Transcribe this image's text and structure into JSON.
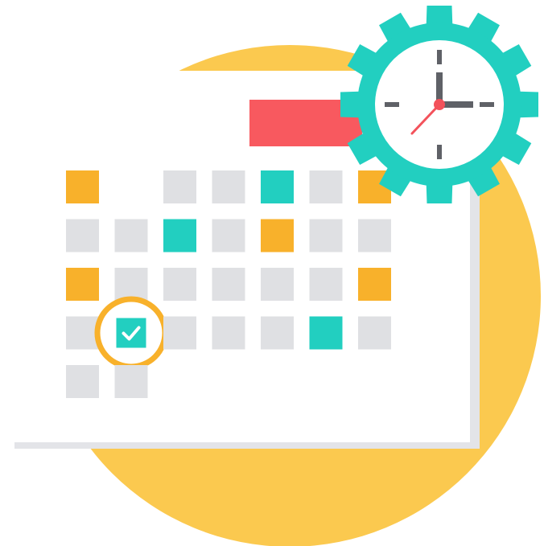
{
  "illustration": {
    "subject": "calendar-with-clock-gear",
    "colors": {
      "background": "#ffffff",
      "circle": "#fbc94f",
      "calendar_page": "#ffffff",
      "calendar_shadow": "#e3e4e8",
      "header_bar": "#f8595f",
      "cell_gray": "#dfe0e3",
      "cell_orange": "#f8b12b",
      "cell_teal": "#22cfc0",
      "ring": "#f8b12b",
      "gear": "#22cfc0",
      "clock_face": "#ffffff",
      "clock_hands": "#5f6167",
      "second_hand": "#f3525b"
    },
    "calendar_grid": {
      "rows": [
        [
          "orange",
          "empty",
          "gray",
          "gray",
          "teal",
          "gray",
          "orange"
        ],
        [
          "gray",
          "gray",
          "teal",
          "gray",
          "orange",
          "gray",
          "gray"
        ],
        [
          "orange",
          "gray",
          "gray",
          "gray",
          "gray",
          "gray",
          "orange"
        ],
        [
          "gray",
          "checked",
          "gray",
          "gray",
          "gray",
          "teal",
          "gray"
        ],
        [
          "gray",
          "gray",
          "empty",
          "empty",
          "empty",
          "empty",
          "empty"
        ]
      ]
    },
    "icons": [
      "calendar-icon",
      "gear-icon",
      "clock-icon",
      "checkmark-icon"
    ]
  }
}
